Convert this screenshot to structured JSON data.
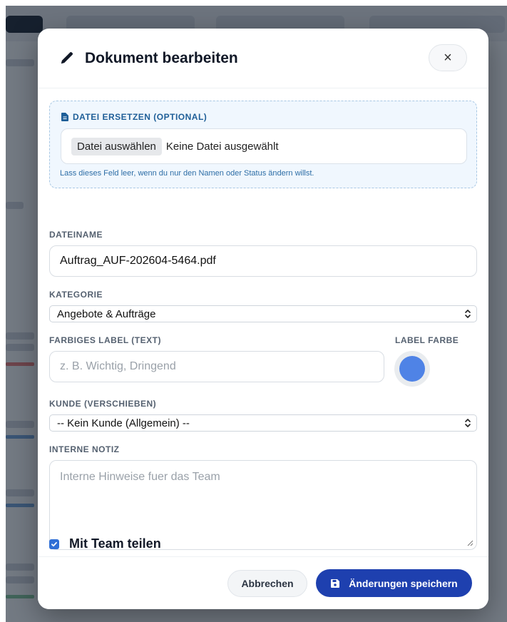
{
  "modal": {
    "title": "Dokument bearbeiten",
    "title_icon": "pencil-icon",
    "close_icon": "close-icon",
    "close_label": "×"
  },
  "file_replace": {
    "label": "DATEI ERSETZEN (OPTIONAL)",
    "label_icon": "file-icon",
    "choose_button": "Datei auswählen",
    "no_file_text": "Keine Datei ausgewählt",
    "hint": "Lass dieses Feld leer, wenn du nur den Namen oder Status ändern willst."
  },
  "filename": {
    "label": "DATEINAME",
    "value": "Auftrag_AUF-202604-5464.pdf"
  },
  "category": {
    "label": "KATEGORIE",
    "selected": "Angebote & Aufträge"
  },
  "color_label": {
    "label": "FARBIGES LABEL (TEXT)",
    "placeholder": "z. B. Wichtig, Dringend",
    "color_label": "LABEL FARBE",
    "color_value": "#4f83e6"
  },
  "customer": {
    "label": "KUNDE (VERSCHIEBEN)",
    "selected": "-- Kein Kunde (Allgemein) --"
  },
  "note": {
    "label": "INTERNE NOTIZ",
    "placeholder": "Interne Hinweise fuer das Team"
  },
  "share": {
    "label": "Mit Team teilen",
    "checked": true
  },
  "footer": {
    "cancel_label": "Abbrechen",
    "save_label": "Änderungen speichern",
    "save_icon": "save-icon"
  },
  "colors": {
    "primary": "#1e40af",
    "checkbox": "#2f6fd6"
  }
}
